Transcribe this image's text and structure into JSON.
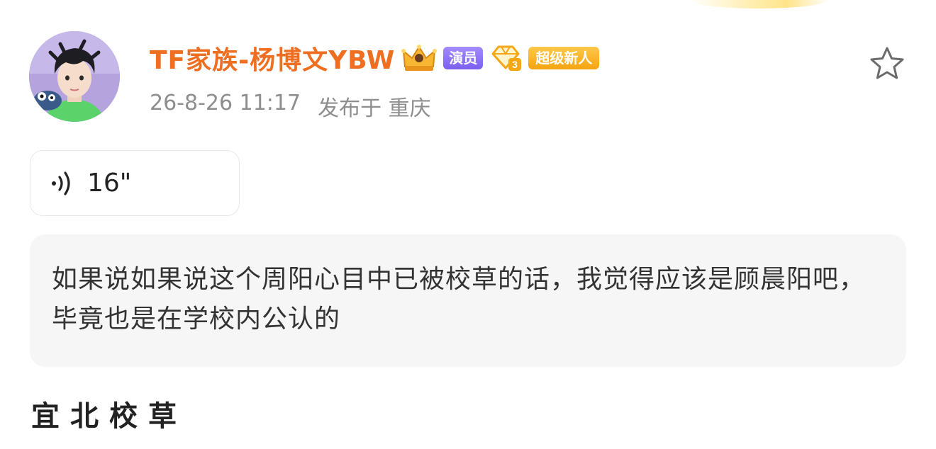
{
  "post": {
    "author": {
      "name": "TF家族-杨博文YBW",
      "badge_actor": "演员",
      "badge_level_number": "3",
      "badge_new": "超级新人"
    },
    "timestamp": "26-8-26 11:17",
    "location": "发布于 重庆",
    "voice": {
      "duration": "16\""
    },
    "quote": "如果说如果说这个周阳心目中已被校草的话，我觉得应该是顾晨阳吧，毕竟也是在学校内公认的",
    "footer_title": "宜北校草"
  },
  "icons": {
    "avatar": "avatar-image",
    "crown": "crown-icon",
    "diamond": "diamond-level-icon",
    "star": "star-outline-icon",
    "voice": "voice-wave-icon"
  },
  "colors": {
    "username": "#ee6e22",
    "badge_actor": "#8b70f5",
    "badge_new": "#f7ac1c",
    "meta": "#8e8e8e",
    "quote_bg": "#f6f6f6"
  }
}
